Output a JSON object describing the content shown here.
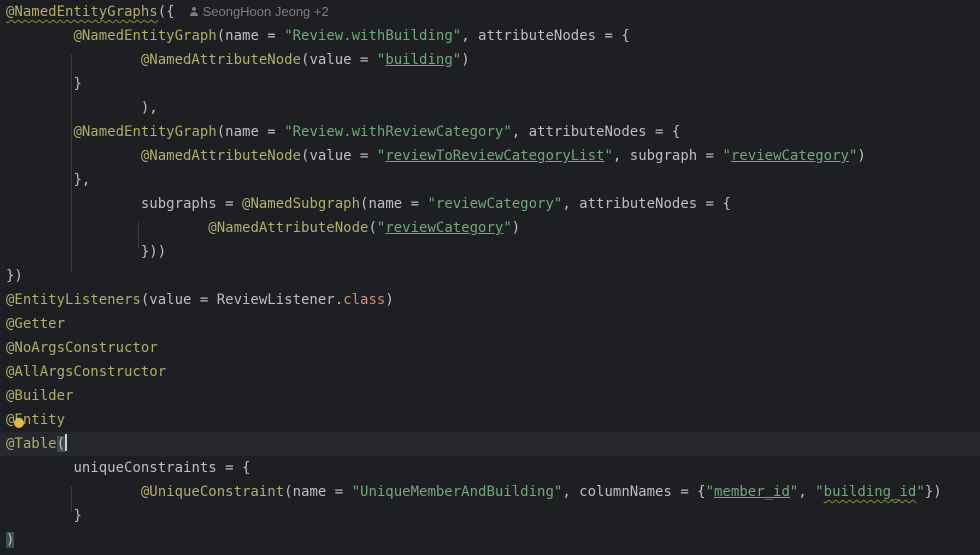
{
  "author_hint": {
    "text": "SeongHoon Jeong +2",
    "icon": "person-icon"
  },
  "code": {
    "l1_ann": "@NamedEntityGraphs",
    "l1_rest": "({",
    "l2_ann": "@NamedEntityGraph",
    "l2_a": "(name = ",
    "l2_str": "\"Review.withBuilding\"",
    "l2_b": ", attributeNodes = {",
    "l3_ann": "@NamedAttributeNode",
    "l3_a": "(value = ",
    "l3_q1": "\"",
    "l3_link": "building",
    "l3_q2": "\"",
    "l3_b": ")",
    "l4": "}",
    "l5": "),",
    "l6_ann": "@NamedEntityGraph",
    "l6_a": "(name = ",
    "l6_str": "\"Review.withReviewCategory\"",
    "l6_b": ", attributeNodes = {",
    "l7_ann": "@NamedAttributeNode",
    "l7_a": "(value = ",
    "l7_q1": "\"",
    "l7_link": "reviewToReviewCategoryList",
    "l7_q2": "\"",
    "l7_b": ", subgraph = ",
    "l7_q3": "\"",
    "l7_link2": "reviewCategory",
    "l7_q4": "\"",
    "l7_c": ")",
    "l8": "},",
    "l9_a": "subgraphs = ",
    "l9_ann": "@NamedSubgraph",
    "l9_b": "(name = ",
    "l9_str": "\"reviewCategory\"",
    "l9_c": ", attributeNodes = {",
    "l10_ann": "@NamedAttributeNode",
    "l10_a": "(",
    "l10_q1": "\"",
    "l10_link": "reviewCategory",
    "l10_q2": "\"",
    "l10_b": ")",
    "l11": "}))",
    "l12": "})",
    "l13_ann": "@EntityListeners",
    "l13_a": "(value = ReviewListener.",
    "l13_kw": "class",
    "l13_b": ")",
    "l14": "@Getter",
    "l15": "@NoArgsConstructor",
    "l16": "@AllArgsConstructor",
    "l17": "@Builder",
    "l18": "@Entity",
    "l19_ann": "@Table",
    "l19_paren": "(",
    "l20": "uniqueConstraints = {",
    "l21_ann": "@UniqueConstraint",
    "l21_a": "(name = ",
    "l21_str": "\"UniqueMemberAndBuilding\"",
    "l21_b": ", columnNames = {",
    "l21_q1": "\"",
    "l21_link1": "member_id",
    "l21_q2": "\"",
    "l21_c": ", ",
    "l21_q3": "\"",
    "l21_link2": "building_id",
    "l21_q4": "\"",
    "l21_d": "})",
    "l22": "}",
    "l23": ")"
  },
  "colors": {
    "background": "#1e1f22",
    "annotation": "#b3ae60",
    "string": "#6aab73",
    "keyword": "#cf8e6d",
    "text": "#bcbec4"
  }
}
